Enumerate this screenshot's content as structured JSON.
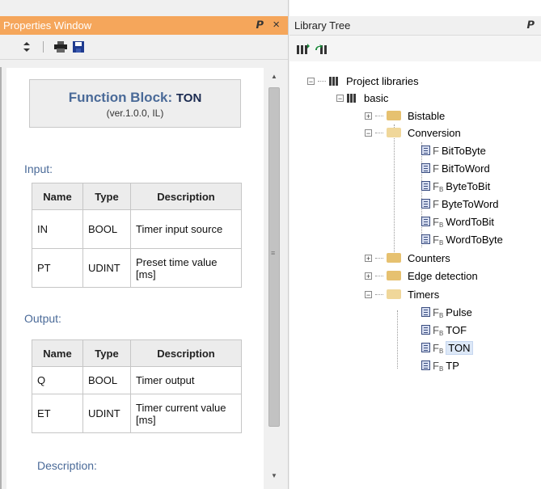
{
  "properties_window": {
    "title": "Properties Window",
    "pin": "ᵖ",
    "close": "×",
    "fb_title_prefix": "Function Block:",
    "fb_name": "TON",
    "fb_version": "(ver.1.0.0, IL)",
    "input_label": "Input:",
    "output_label": "Output:",
    "description_label": "Description:",
    "table_headers": [
      "Name",
      "Type",
      "Description"
    ],
    "inputs": [
      {
        "name": "IN",
        "type": "BOOL",
        "description": "Timer input source"
      },
      {
        "name": "PT",
        "type": "UDINT",
        "description": "Preset time value [ms]"
      }
    ],
    "outputs": [
      {
        "name": "Q",
        "type": "BOOL",
        "description": "Timer output"
      },
      {
        "name": "ET",
        "type": "UDINT",
        "description": "Timer current value [ms]"
      }
    ],
    "toolbar_icons": [
      "sort-icon",
      "print-icon",
      "save-icon"
    ]
  },
  "library_tree": {
    "title": "Library Tree",
    "pin": "ᵖ",
    "root": "Project libraries",
    "library": "basic",
    "folders": {
      "bistable": "Bistable",
      "conversion": "Conversion",
      "counters": "Counters",
      "edge": "Edge detection",
      "timers": "Timers"
    },
    "conversion_items": [
      {
        "kind": "F",
        "label": "BitToByte"
      },
      {
        "kind": "F",
        "label": "BitToWord"
      },
      {
        "kind": "FB",
        "label": "ByteToBit"
      },
      {
        "kind": "F",
        "label": "ByteToWord"
      },
      {
        "kind": "FB",
        "label": "WordToBit"
      },
      {
        "kind": "FB",
        "label": "WordToByte"
      }
    ],
    "timer_items": [
      {
        "kind": "FB",
        "label": "Pulse"
      },
      {
        "kind": "FB",
        "label": "TOF"
      },
      {
        "kind": "FB",
        "label": "TON",
        "selected": true
      },
      {
        "kind": "FB",
        "label": "TP"
      }
    ]
  },
  "colors": {
    "accent_title": "#f5a65b",
    "heading_blue": "#4a6a98",
    "selection": "#dde8f7"
  }
}
